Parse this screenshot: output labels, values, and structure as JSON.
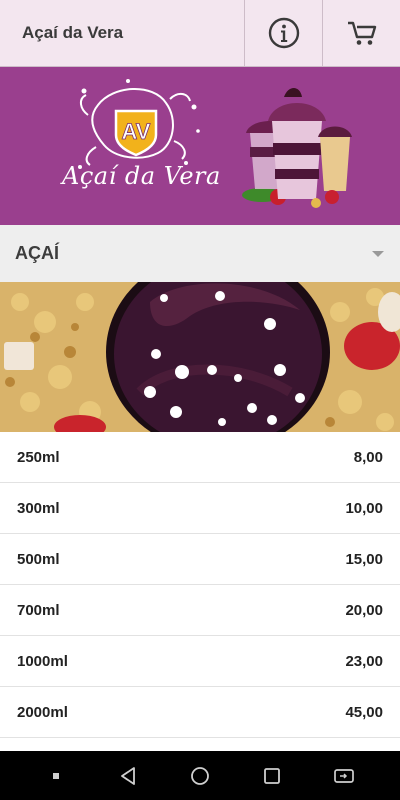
{
  "header": {
    "title": "Açaí da Vera",
    "info_icon": "info-icon",
    "cart_icon": "cart-icon"
  },
  "banner": {
    "logo_text": "Açaí da Vera",
    "logo_letters": "AV"
  },
  "category": {
    "label": "AÇAÍ",
    "expand_icon": "caret-down-icon"
  },
  "menu": {
    "items": [
      {
        "size": "250ml",
        "price": "8,00"
      },
      {
        "size": "300ml",
        "price": "10,00"
      },
      {
        "size": "500ml",
        "price": "15,00"
      },
      {
        "size": "700ml",
        "price": "20,00"
      },
      {
        "size": "1000ml",
        "price": "23,00"
      },
      {
        "size": "2000ml",
        "price": "45,00"
      }
    ]
  },
  "navbar": {
    "icons": [
      "dot-icon",
      "back-icon",
      "home-icon",
      "recents-icon",
      "rotate-icon"
    ]
  },
  "colors": {
    "header_bg": "#f3e6ef",
    "banner_bg": "#9a3f8e",
    "category_bg": "#eeeeee",
    "acai": "#3a1530"
  }
}
